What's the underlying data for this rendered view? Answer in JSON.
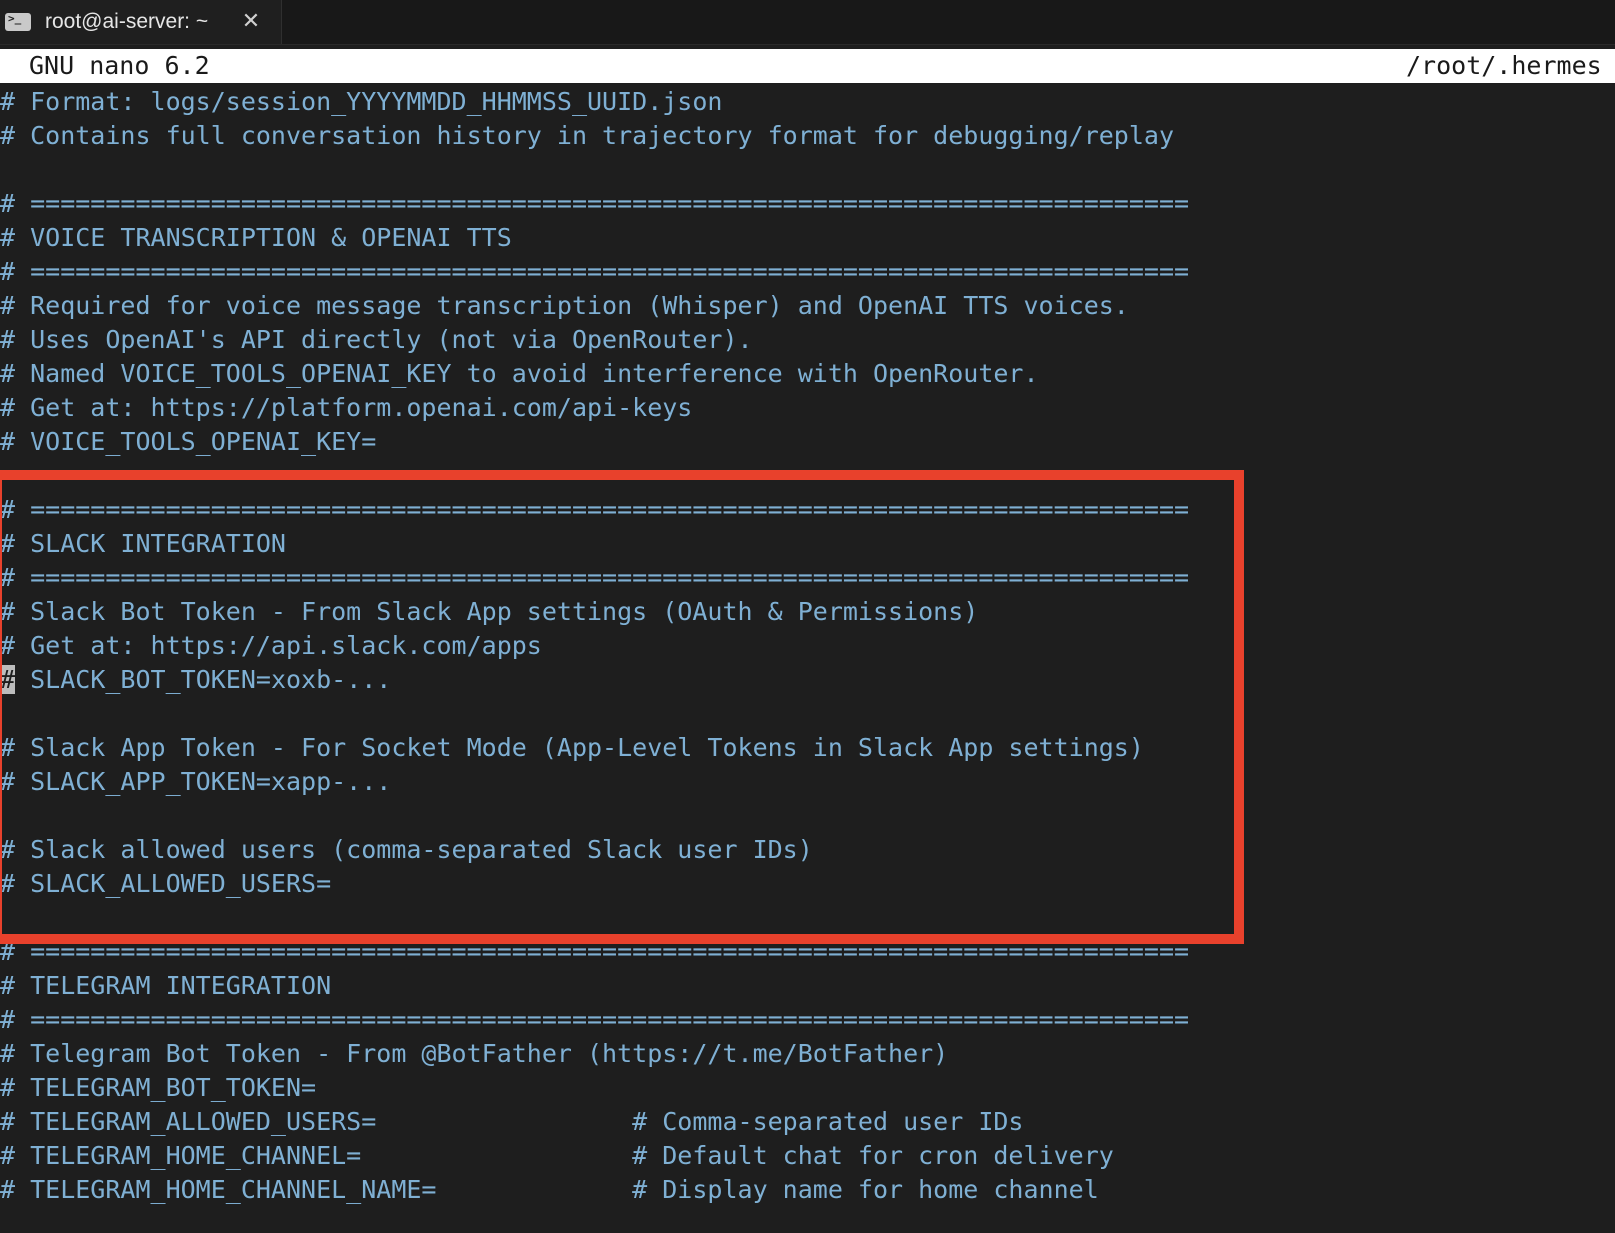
{
  "tab": {
    "title": "root@ai-server: ~",
    "icon": "terminal-icon",
    "close_glyph": "✕"
  },
  "nano": {
    "title": "GNU nano 6.2",
    "file_path": "/root/.hermes"
  },
  "lines": [
    "# Format: logs/session_YYYYMMDD_HHMMSS_UUID.json",
    "# Contains full conversation history in trajectory format for debugging/replay",
    "",
    "# =============================================================================",
    "# VOICE TRANSCRIPTION & OPENAI TTS",
    "# =============================================================================",
    "# Required for voice message transcription (Whisper) and OpenAI TTS voices.",
    "# Uses OpenAI's API directly (not via OpenRouter).",
    "# Named VOICE_TOOLS_OPENAI_KEY to avoid interference with OpenRouter.",
    "# Get at: https://platform.openai.com/api-keys",
    "# VOICE_TOOLS_OPENAI_KEY=",
    "",
    "# =============================================================================",
    "# SLACK INTEGRATION",
    "# =============================================================================",
    "# Slack Bot Token - From Slack App settings (OAuth & Permissions)",
    "# Get at: https://api.slack.com/apps",
    "SLACK_BOT_TOKEN=xoxb-...",
    "",
    "# Slack App Token - For Socket Mode (App-Level Tokens in Slack App settings)",
    "# SLACK_APP_TOKEN=xapp-...",
    "",
    "# Slack allowed users (comma-separated Slack user IDs)",
    "# SLACK_ALLOWED_USERS=",
    "",
    "# =============================================================================",
    "# TELEGRAM INTEGRATION",
    "# =============================================================================",
    "# Telegram Bot Token - From @BotFather (https://t.me/BotFather)",
    "# TELEGRAM_BOT_TOKEN=",
    "# TELEGRAM_ALLOWED_USERS=                 # Comma-separated user IDs",
    "# TELEGRAM_HOME_CHANNEL=                  # Default chat for cron delivery",
    "# TELEGRAM_HOME_CHANNEL_NAME=             # Display name for home channel"
  ],
  "cursor": {
    "line_index": 17,
    "char": "#",
    "rest": " "
  },
  "colors": {
    "text": "#7fb0d4",
    "background": "#1e1e1e",
    "highlight_box": "#e8412c"
  }
}
